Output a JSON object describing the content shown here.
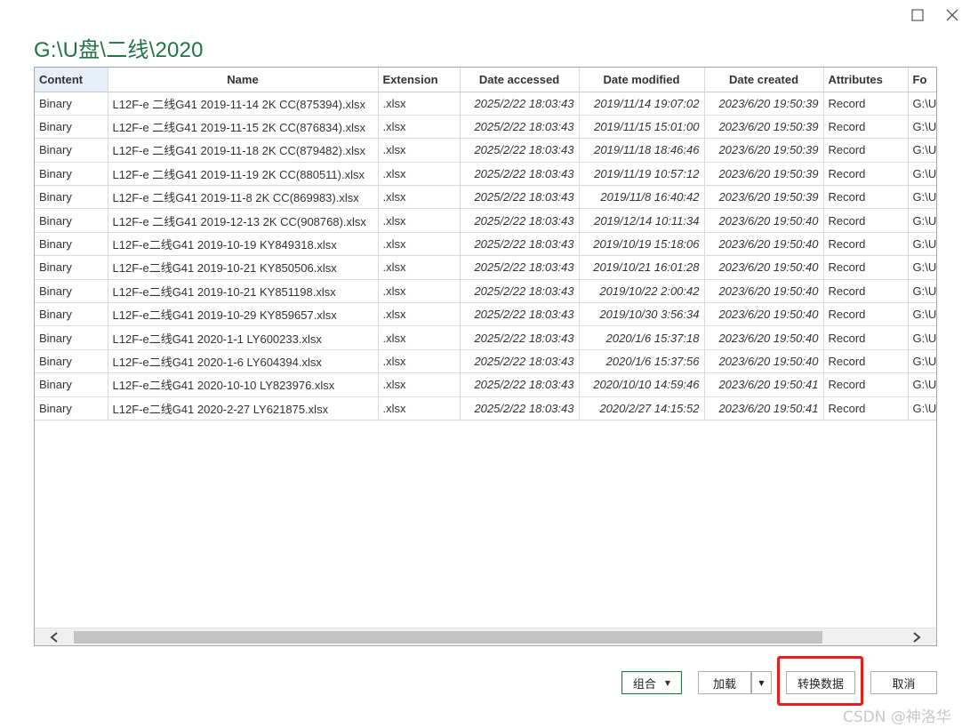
{
  "window": {
    "title": "G:\\U盘\\二线\\2020",
    "maximize_icon": "maximize-icon",
    "close_icon": "close-icon"
  },
  "table": {
    "columns": [
      "Content",
      "Name",
      "Extension",
      "Date accessed",
      "Date modified",
      "Date created",
      "Attributes",
      "Fo"
    ],
    "rows": [
      [
        "Binary",
        "L12F-e 二线G41 2019-11-14 2K CC(875394).xlsx",
        ".xlsx",
        "2025/2/22 18:03:43",
        "2019/11/14 19:07:02",
        "2023/6/20 19:50:39",
        "Record",
        "G:\\U"
      ],
      [
        "Binary",
        "L12F-e 二线G41 2019-11-15 2K CC(876834).xlsx",
        ".xlsx",
        "2025/2/22 18:03:43",
        "2019/11/15 15:01:00",
        "2023/6/20 19:50:39",
        "Record",
        "G:\\U"
      ],
      [
        "Binary",
        "L12F-e 二线G41 2019-11-18 2K CC(879482).xlsx",
        ".xlsx",
        "2025/2/22 18:03:43",
        "2019/11/18 18:46:46",
        "2023/6/20 19:50:39",
        "Record",
        "G:\\U"
      ],
      [
        "Binary",
        "L12F-e 二线G41 2019-11-19 2K CC(880511).xlsx",
        ".xlsx",
        "2025/2/22 18:03:43",
        "2019/11/19 10:57:12",
        "2023/6/20 19:50:39",
        "Record",
        "G:\\U"
      ],
      [
        "Binary",
        "L12F-e 二线G41 2019-11-8 2K CC(869983).xlsx",
        ".xlsx",
        "2025/2/22 18:03:43",
        "2019/11/8 16:40:42",
        "2023/6/20 19:50:39",
        "Record",
        "G:\\U"
      ],
      [
        "Binary",
        "L12F-e 二线G41 2019-12-13 2K CC(908768).xlsx",
        ".xlsx",
        "2025/2/22 18:03:43",
        "2019/12/14 10:11:34",
        "2023/6/20 19:50:40",
        "Record",
        "G:\\U"
      ],
      [
        "Binary",
        "L12F-e二线G41 2019-10-19 KY849318.xlsx",
        ".xlsx",
        "2025/2/22 18:03:43",
        "2019/10/19 15:18:06",
        "2023/6/20 19:50:40",
        "Record",
        "G:\\U"
      ],
      [
        "Binary",
        "L12F-e二线G41 2019-10-21 KY850506.xlsx",
        ".xlsx",
        "2025/2/22 18:03:43",
        "2019/10/21 16:01:28",
        "2023/6/20 19:50:40",
        "Record",
        "G:\\U"
      ],
      [
        "Binary",
        "L12F-e二线G41 2019-10-21 KY851198.xlsx",
        ".xlsx",
        "2025/2/22 18:03:43",
        "2019/10/22 2:00:42",
        "2023/6/20 19:50:40",
        "Record",
        "G:\\U"
      ],
      [
        "Binary",
        "L12F-e二线G41 2019-10-29 KY859657.xlsx",
        ".xlsx",
        "2025/2/22 18:03:43",
        "2019/10/30 3:56:34",
        "2023/6/20 19:50:40",
        "Record",
        "G:\\U"
      ],
      [
        "Binary",
        "L12F-e二线G41 2020-1-1 LY600233.xlsx",
        ".xlsx",
        "2025/2/22 18:03:43",
        "2020/1/6 15:37:18",
        "2023/6/20 19:50:40",
        "Record",
        "G:\\U"
      ],
      [
        "Binary",
        "L12F-e二线G41 2020-1-6 LY604394.xlsx",
        ".xlsx",
        "2025/2/22 18:03:43",
        "2020/1/6 15:37:56",
        "2023/6/20 19:50:40",
        "Record",
        "G:\\U"
      ],
      [
        "Binary",
        "L12F-e二线G41 2020-10-10 LY823976.xlsx",
        ".xlsx",
        "2025/2/22 18:03:43",
        "2020/10/10 14:59:46",
        "2023/6/20 19:50:41",
        "Record",
        "G:\\U"
      ],
      [
        "Binary",
        "L12F-e二线G41 2020-2-27 LY621875.xlsx",
        ".xlsx",
        "2025/2/22 18:03:43",
        "2020/2/27 14:15:52",
        "2023/6/20 19:50:41",
        "Record",
        "G:\\U"
      ]
    ]
  },
  "scrollbar": {
    "left_icon": "chevron-left-icon",
    "right_icon": "chevron-right-icon"
  },
  "buttons": {
    "combine": "组合",
    "load": "加载",
    "transform": "转换数据",
    "cancel": "取消"
  },
  "watermark": "CSDN @神洛华",
  "colors": {
    "accent": "#217346",
    "highlight": "#e5201f",
    "header_first": "#e6eef7"
  }
}
